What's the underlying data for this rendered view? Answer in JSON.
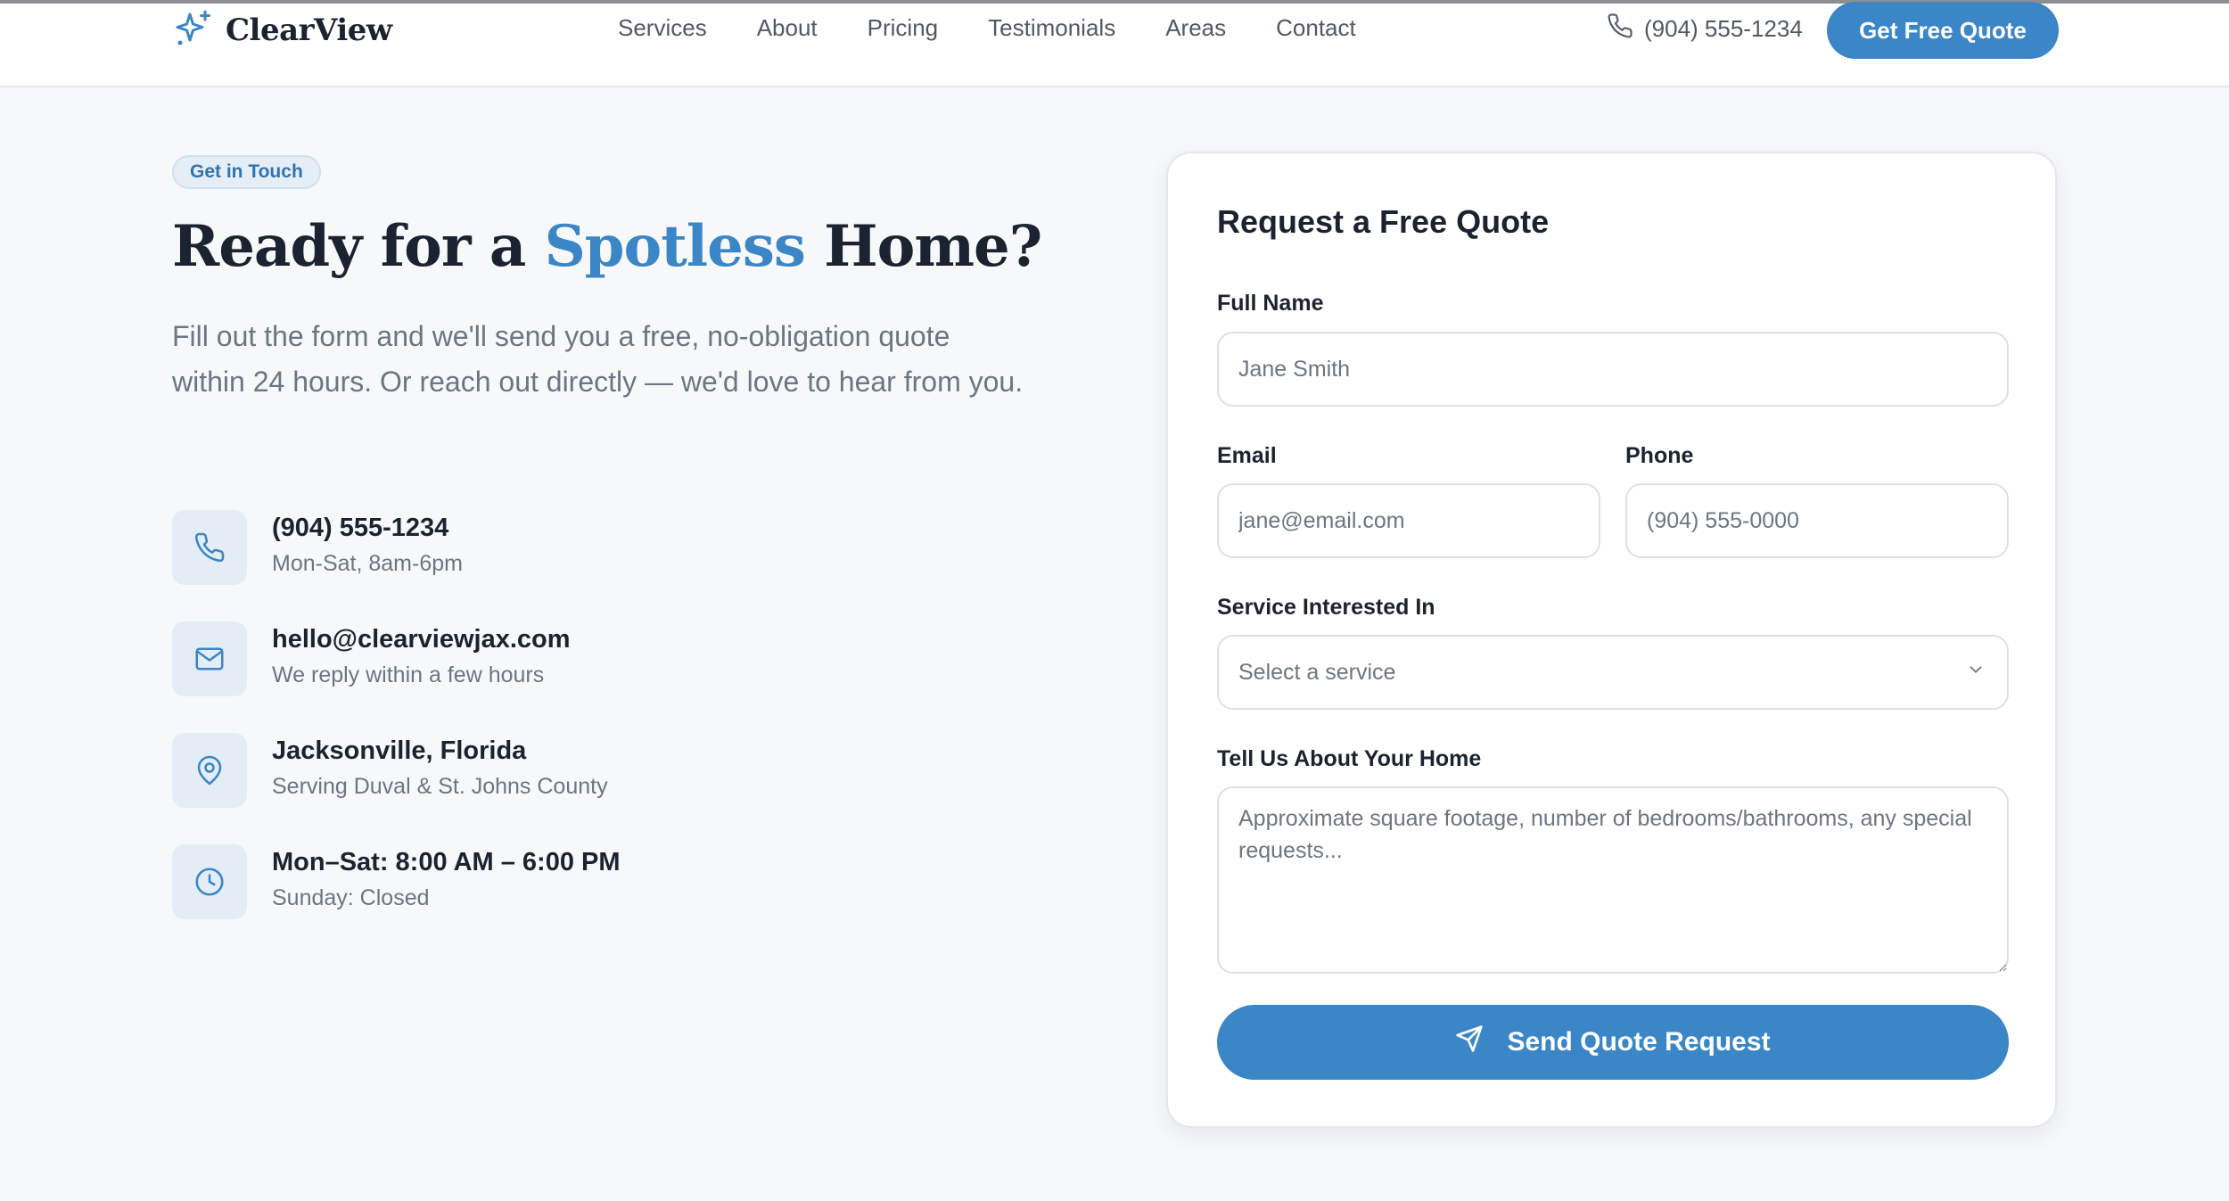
{
  "header": {
    "logo_text": "ClearView",
    "logo_icon": "sparkle-icon",
    "nav": [
      "Services",
      "About",
      "Pricing",
      "Testimonials",
      "Areas",
      "Contact"
    ],
    "phone": "(904) 555-1234",
    "cta_label": "Get Free Quote"
  },
  "hero": {
    "badge": "Get in Touch",
    "headline_before": "Ready for a ",
    "headline_accent": "Spotless",
    "headline_after": " Home?",
    "lede": "Fill out the form and we'll send you a free, no-obligation quote within 24 hours. Or reach out directly — we'd love to hear from you."
  },
  "contacts": [
    {
      "icon": "phone-icon",
      "title": "(904) 555-1234",
      "subtitle": "Mon-Sat, 8am-6pm"
    },
    {
      "icon": "mail-icon",
      "title": "hello@clearviewjax.com",
      "subtitle": "We reply within a few hours"
    },
    {
      "icon": "map-pin-icon",
      "title": "Jacksonville, Florida",
      "subtitle": "Serving Duval & St. Johns County"
    },
    {
      "icon": "clock-icon",
      "title": "Mon–Sat: 8:00 AM – 6:00 PM",
      "subtitle": "Sunday: Closed"
    }
  ],
  "form": {
    "title": "Request a Free Quote",
    "full_name": {
      "label": "Full Name",
      "placeholder": "Jane Smith"
    },
    "email": {
      "label": "Email",
      "placeholder": "jane@email.com"
    },
    "phone": {
      "label": "Phone",
      "placeholder": "(904) 555-0000"
    },
    "service": {
      "label": "Service Interested In",
      "selected": "Select a service"
    },
    "home": {
      "label": "Tell Us About Your Home",
      "placeholder": "Approximate square footage, number of bedrooms/bathrooms, any special requests..."
    },
    "submit_label": "Send Quote Request",
    "submit_icon": "send-icon"
  },
  "colors": {
    "accent": "#3a86c6",
    "page_background": "#f7f8fa",
    "text_dark": "#1c2330",
    "text_muted": "#6b7683",
    "icon_tile": "#e4edf6"
  }
}
